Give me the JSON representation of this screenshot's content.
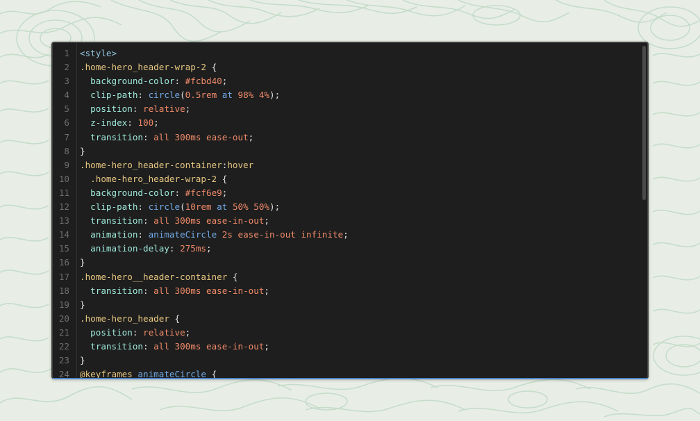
{
  "code_editor": {
    "lines": [
      {
        "number": "1",
        "tokens": [
          {
            "type": "tag",
            "text": "<style>"
          }
        ]
      },
      {
        "number": "2",
        "tokens": [
          {
            "type": "sel",
            "text": ".home-hero_header-wrap-2 "
          },
          {
            "type": "punc",
            "text": "{"
          }
        ]
      },
      {
        "number": "3",
        "tokens": [
          {
            "type": "prop",
            "text": "  background-color"
          },
          {
            "type": "punc",
            "text": ": "
          },
          {
            "type": "val",
            "text": "#fcbd40"
          },
          {
            "type": "punc",
            "text": ";"
          }
        ]
      },
      {
        "number": "4",
        "tokens": [
          {
            "type": "prop",
            "text": "  clip-path"
          },
          {
            "type": "punc",
            "text": ": "
          },
          {
            "type": "func",
            "text": "circle"
          },
          {
            "type": "punc",
            "text": "("
          },
          {
            "type": "val",
            "text": "0.5rem"
          },
          {
            "type": "func",
            "text": " at "
          },
          {
            "type": "val",
            "text": "98% 4%"
          },
          {
            "type": "punc",
            "text": ");"
          }
        ]
      },
      {
        "number": "5",
        "tokens": [
          {
            "type": "prop",
            "text": "  position"
          },
          {
            "type": "punc",
            "text": ": "
          },
          {
            "type": "val",
            "text": "relative"
          },
          {
            "type": "punc",
            "text": ";"
          }
        ]
      },
      {
        "number": "6",
        "tokens": [
          {
            "type": "prop",
            "text": "  z-index"
          },
          {
            "type": "punc",
            "text": ": "
          },
          {
            "type": "val",
            "text": "100"
          },
          {
            "type": "punc",
            "text": ";"
          }
        ]
      },
      {
        "number": "7",
        "tokens": [
          {
            "type": "prop",
            "text": "  transition"
          },
          {
            "type": "punc",
            "text": ": "
          },
          {
            "type": "val",
            "text": "all 300ms ease-out"
          },
          {
            "type": "punc",
            "text": ";"
          }
        ]
      },
      {
        "number": "8",
        "tokens": [
          {
            "type": "punc",
            "text": "}"
          }
        ]
      },
      {
        "number": "9",
        "tokens": [
          {
            "type": "sel",
            "text": ".home-hero_header-container"
          },
          {
            "type": "punc",
            "text": ":"
          },
          {
            "type": "kw",
            "text": "hover"
          }
        ]
      },
      {
        "number": "10",
        "tokens": [
          {
            "type": "sel",
            "text": "  .home-hero_header-wrap-2 "
          },
          {
            "type": "punc",
            "text": "{"
          }
        ]
      },
      {
        "number": "11",
        "tokens": [
          {
            "type": "prop",
            "text": "  background-color"
          },
          {
            "type": "punc",
            "text": ": "
          },
          {
            "type": "val",
            "text": "#fcf6e9"
          },
          {
            "type": "punc",
            "text": ";"
          }
        ]
      },
      {
        "number": "12",
        "tokens": [
          {
            "type": "prop",
            "text": "  clip-path"
          },
          {
            "type": "punc",
            "text": ": "
          },
          {
            "type": "func",
            "text": "circle"
          },
          {
            "type": "punc",
            "text": "("
          },
          {
            "type": "val",
            "text": "10rem"
          },
          {
            "type": "func",
            "text": " at "
          },
          {
            "type": "val",
            "text": "50% 50%"
          },
          {
            "type": "punc",
            "text": ");"
          }
        ]
      },
      {
        "number": "13",
        "tokens": [
          {
            "type": "prop",
            "text": "  transition"
          },
          {
            "type": "punc",
            "text": ": "
          },
          {
            "type": "val",
            "text": "all 300ms ease-in-out"
          },
          {
            "type": "punc",
            "text": ";"
          }
        ]
      },
      {
        "number": "14",
        "tokens": [
          {
            "type": "prop",
            "text": "  animation"
          },
          {
            "type": "punc",
            "text": ": "
          },
          {
            "type": "func",
            "text": "animateCircle"
          },
          {
            "type": "val",
            "text": " 2s ease-in-out infinite"
          },
          {
            "type": "punc",
            "text": ";"
          }
        ]
      },
      {
        "number": "15",
        "tokens": [
          {
            "type": "prop",
            "text": "  animation-delay"
          },
          {
            "type": "punc",
            "text": ": "
          },
          {
            "type": "val",
            "text": "275ms"
          },
          {
            "type": "punc",
            "text": ";"
          }
        ]
      },
      {
        "number": "16",
        "tokens": [
          {
            "type": "punc",
            "text": "}"
          }
        ]
      },
      {
        "number": "17",
        "tokens": [
          {
            "type": "sel",
            "text": ".home-hero__header-container "
          },
          {
            "type": "punc",
            "text": "{"
          }
        ]
      },
      {
        "number": "18",
        "tokens": [
          {
            "type": "prop",
            "text": "  transition"
          },
          {
            "type": "punc",
            "text": ": "
          },
          {
            "type": "val",
            "text": "all 300ms ease-in-out"
          },
          {
            "type": "punc",
            "text": ";"
          }
        ]
      },
      {
        "number": "19",
        "tokens": [
          {
            "type": "punc",
            "text": "}"
          }
        ]
      },
      {
        "number": "20",
        "tokens": [
          {
            "type": "sel",
            "text": ".home-hero_header "
          },
          {
            "type": "punc",
            "text": "{"
          }
        ]
      },
      {
        "number": "21",
        "tokens": [
          {
            "type": "prop",
            "text": "  position"
          },
          {
            "type": "punc",
            "text": ": "
          },
          {
            "type": "val",
            "text": "relative"
          },
          {
            "type": "punc",
            "text": ";"
          }
        ]
      },
      {
        "number": "22",
        "tokens": [
          {
            "type": "prop",
            "text": "  transition"
          },
          {
            "type": "punc",
            "text": ": "
          },
          {
            "type": "val",
            "text": "all 300ms ease-in-out"
          },
          {
            "type": "punc",
            "text": ";"
          }
        ]
      },
      {
        "number": "23",
        "tokens": [
          {
            "type": "punc",
            "text": "}"
          }
        ]
      },
      {
        "number": "24",
        "tokens": [
          {
            "type": "sel",
            "text": "@keyframes "
          },
          {
            "type": "func",
            "text": "animateCircle"
          },
          {
            "type": "punc",
            "text": " {"
          }
        ]
      }
    ]
  },
  "colors": {
    "background": "#e8eee5",
    "pattern_stroke": "#c6dccb",
    "editor_background": "#1e1e1e",
    "focus_border": "#4c83c9"
  }
}
